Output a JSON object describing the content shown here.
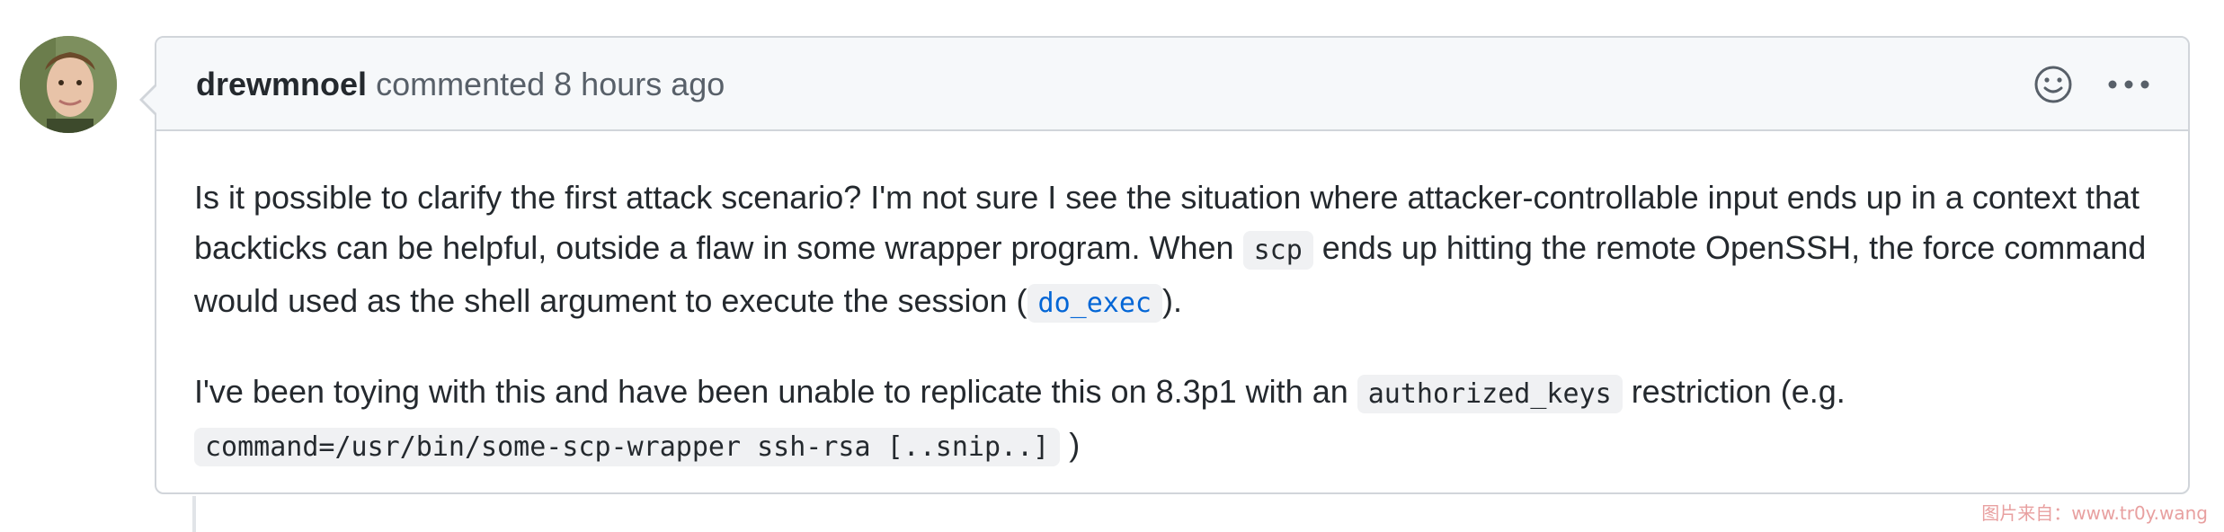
{
  "comment": {
    "author": "drewmnoel",
    "meta": "commented 8 hours ago",
    "paragraph1": {
      "part1": "Is it possible to clarify the first attack scenario? I'm not sure I see the situation where attacker-controllable input ends up in a context that backticks can be helpful, outside a flaw in some wrapper program. When ",
      "code1": "scp",
      "part2": " ends up hitting the remote OpenSSH, the force command would used as the shell argument to execute the session (",
      "code2": "do_exec",
      "part3": ")."
    },
    "paragraph2": {
      "part1": "I've been toying with this and have been unable to replicate this on 8.3p1 with an ",
      "code1": "authorized_keys",
      "part2": " restriction (e.g. ",
      "code2": "command=/usr/bin/some-scp-wrapper ssh-rsa [..snip..]",
      "part3": " )"
    }
  },
  "icons": {
    "reaction": "smiley-icon",
    "more": "kebab-horizontal-icon"
  },
  "colors": {
    "link": "#0366d6",
    "header_bg": "#f6f8fa",
    "border": "#d1d5da"
  },
  "watermark": "图片来自：www.tr0y.wang"
}
